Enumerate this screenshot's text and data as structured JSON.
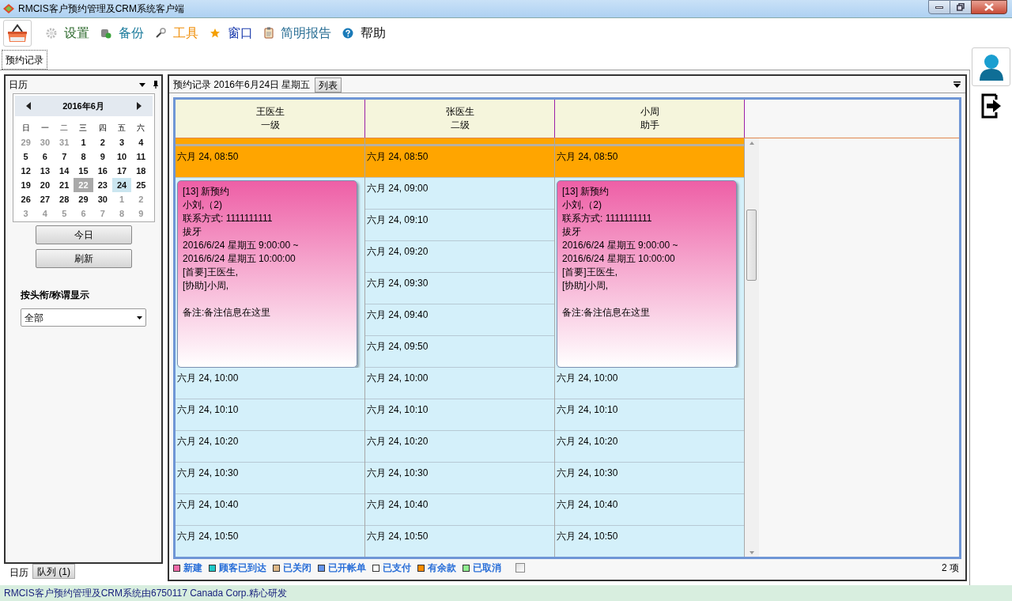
{
  "window": {
    "title": "RMCIS客户预约管理及CRM系统客户端"
  },
  "menu": [
    {
      "label": "设置",
      "color": "#2f6b2f",
      "kind": "gear"
    },
    {
      "label": "备份",
      "color": "#1f7d9e",
      "kind": "database"
    },
    {
      "label": "工具",
      "color": "#f0900c",
      "kind": "wrench"
    },
    {
      "label": "窗口",
      "color": "#1f3fae",
      "kind": "star"
    },
    {
      "label": "简明报告",
      "color": "#2a6f95",
      "kind": "clipboard"
    },
    {
      "label": "帮助",
      "color": "#111111",
      "kind": "help"
    }
  ],
  "doc_tabs": [
    {
      "label": "预约记录",
      "selected": true
    }
  ],
  "calendar_panel": {
    "title": "日历",
    "month": "2016年6月",
    "weekdays": [
      "日",
      "一",
      "二",
      "三",
      "四",
      "五",
      "六"
    ],
    "weeks": [
      [
        {
          "day": "29",
          "muted": true,
          "selected": false,
          "highlighted": false
        },
        {
          "day": "30",
          "muted": true,
          "selected": false,
          "highlighted": false
        },
        {
          "day": "31",
          "muted": true,
          "selected": false,
          "highlighted": false
        },
        {
          "day": "1",
          "muted": false,
          "selected": false,
          "highlighted": false
        },
        {
          "day": "2",
          "muted": false,
          "selected": false,
          "highlighted": false
        },
        {
          "day": "3",
          "muted": false,
          "selected": false,
          "highlighted": false
        },
        {
          "day": "4",
          "muted": false,
          "selected": false,
          "highlighted": false
        }
      ],
      [
        {
          "day": "5",
          "muted": false,
          "selected": false,
          "highlighted": false
        },
        {
          "day": "6",
          "muted": false,
          "selected": false,
          "highlighted": false
        },
        {
          "day": "7",
          "muted": false,
          "selected": false,
          "highlighted": false
        },
        {
          "day": "8",
          "muted": false,
          "selected": false,
          "highlighted": false
        },
        {
          "day": "9",
          "muted": false,
          "selected": false,
          "highlighted": false
        },
        {
          "day": "10",
          "muted": false,
          "selected": false,
          "highlighted": false
        },
        {
          "day": "11",
          "muted": false,
          "selected": false,
          "highlighted": false
        }
      ],
      [
        {
          "day": "12",
          "muted": false,
          "selected": false,
          "highlighted": false
        },
        {
          "day": "13",
          "muted": false,
          "selected": false,
          "highlighted": false
        },
        {
          "day": "14",
          "muted": false,
          "selected": false,
          "highlighted": false
        },
        {
          "day": "15",
          "muted": false,
          "selected": false,
          "highlighted": false
        },
        {
          "day": "16",
          "muted": false,
          "selected": false,
          "highlighted": false
        },
        {
          "day": "17",
          "muted": false,
          "selected": false,
          "highlighted": false
        },
        {
          "day": "18",
          "muted": false,
          "selected": false,
          "highlighted": false
        }
      ],
      [
        {
          "day": "19",
          "muted": false,
          "selected": false,
          "highlighted": false
        },
        {
          "day": "20",
          "muted": false,
          "selected": false,
          "highlighted": false
        },
        {
          "day": "21",
          "muted": false,
          "selected": false,
          "highlighted": false
        },
        {
          "day": "22",
          "muted": false,
          "selected": true,
          "highlighted": false
        },
        {
          "day": "23",
          "muted": false,
          "selected": false,
          "highlighted": false
        },
        {
          "day": "24",
          "muted": false,
          "selected": false,
          "highlighted": true
        },
        {
          "day": "25",
          "muted": false,
          "selected": false,
          "highlighted": false
        }
      ],
      [
        {
          "day": "26",
          "muted": false,
          "selected": false,
          "highlighted": false
        },
        {
          "day": "27",
          "muted": false,
          "selected": false,
          "highlighted": false
        },
        {
          "day": "28",
          "muted": false,
          "selected": false,
          "highlighted": false
        },
        {
          "day": "29",
          "muted": false,
          "selected": false,
          "highlighted": false
        },
        {
          "day": "30",
          "muted": false,
          "selected": false,
          "highlighted": false
        },
        {
          "day": "1",
          "muted": true,
          "selected": false,
          "highlighted": false
        },
        {
          "day": "2",
          "muted": true,
          "selected": false,
          "highlighted": false
        }
      ],
      [
        {
          "day": "3",
          "muted": true,
          "selected": false,
          "highlighted": false
        },
        {
          "day": "4",
          "muted": true,
          "selected": false,
          "highlighted": false
        },
        {
          "day": "5",
          "muted": true,
          "selected": false,
          "highlighted": false
        },
        {
          "day": "6",
          "muted": true,
          "selected": false,
          "highlighted": false
        },
        {
          "day": "7",
          "muted": true,
          "selected": false,
          "highlighted": false
        },
        {
          "day": "8",
          "muted": true,
          "selected": false,
          "highlighted": false
        },
        {
          "day": "9",
          "muted": true,
          "selected": false,
          "highlighted": false
        }
      ]
    ],
    "buttons": [
      "今日",
      "刷新"
    ],
    "filter": {
      "label": "按头衔/称谓显示",
      "value": "全部"
    },
    "bottom_tabs": [
      {
        "label": "日历",
        "selected": true
      },
      {
        "label": "队列 (1)",
        "selected": false
      }
    ]
  },
  "schedule": {
    "title": "预约记录 2016年6月24日 星期五",
    "view_button": "列表",
    "columns": [
      {
        "name": "王医生",
        "rank": "一级",
        "entries": [
          {
            "kind": "slot",
            "time": "六月 24, 08:50",
            "color": "#ffa500"
          },
          {
            "kind": "appointment",
            "color": "#ee5fa6",
            "lines": [
              "[13] 新预约",
              "小刘,（2)",
              "联系方式: 1111111111",
              "拔牙",
              "2016/6/24 星期五 9:00:00 ~",
              "2016/6/24 星期五 10:00:00",
              "[首要]王医生,",
              "[协助]小周,"
            ],
            "notes": "备注:备注信息在这里"
          },
          {
            "kind": "slot",
            "time": "六月 24, 10:00",
            "color": "#d4f0fa"
          },
          {
            "kind": "slot",
            "time": "六月 24, 10:10",
            "color": "#d4f0fa"
          },
          {
            "kind": "slot",
            "time": "六月 24, 10:20",
            "color": "#d4f0fa"
          },
          {
            "kind": "slot",
            "time": "六月 24, 10:30",
            "color": "#d4f0fa"
          },
          {
            "kind": "slot",
            "time": "六月 24, 10:40",
            "color": "#d4f0fa"
          },
          {
            "kind": "slot",
            "time": "六月 24, 10:50",
            "color": "#d4f0fa"
          }
        ]
      },
      {
        "name": "张医生",
        "rank": "二级",
        "entries": [
          {
            "kind": "slot",
            "time": "六月 24, 08:50",
            "color": "#ffa500"
          },
          {
            "kind": "slot",
            "time": "六月 24, 09:00",
            "color": "#d4f0fa"
          },
          {
            "kind": "slot",
            "time": "六月 24, 09:10",
            "color": "#d4f0fa"
          },
          {
            "kind": "slot",
            "time": "六月 24, 09:20",
            "color": "#d4f0fa"
          },
          {
            "kind": "slot",
            "time": "六月 24, 09:30",
            "color": "#d4f0fa"
          },
          {
            "kind": "slot",
            "time": "六月 24, 09:40",
            "color": "#d4f0fa"
          },
          {
            "kind": "slot",
            "time": "六月 24, 09:50",
            "color": "#d4f0fa"
          },
          {
            "kind": "slot",
            "time": "六月 24, 10:00",
            "color": "#d4f0fa"
          },
          {
            "kind": "slot",
            "time": "六月 24, 10:10",
            "color": "#d4f0fa"
          },
          {
            "kind": "slot",
            "time": "六月 24, 10:20",
            "color": "#d4f0fa"
          },
          {
            "kind": "slot",
            "time": "六月 24, 10:30",
            "color": "#d4f0fa"
          },
          {
            "kind": "slot",
            "time": "六月 24, 10:40",
            "color": "#d4f0fa"
          },
          {
            "kind": "slot",
            "time": "六月 24, 10:50",
            "color": "#d4f0fa"
          }
        ]
      },
      {
        "name": "小周",
        "rank": "助手",
        "entries": [
          {
            "kind": "slot",
            "time": "六月 24, 08:50",
            "color": "#ffa500"
          },
          {
            "kind": "appointment",
            "color": "#ee5fa6",
            "lines": [
              "[13] 新预约",
              "小刘,（2)",
              "联系方式: 1111111111",
              "拔牙",
              "2016/6/24 星期五 9:00:00 ~",
              "2016/6/24 星期五 10:00:00",
              "[首要]王医生,",
              "[协助]小周,"
            ],
            "notes": "备注:备注信息在这里"
          },
          {
            "kind": "slot",
            "time": "六月 24, 10:00",
            "color": "#d4f0fa"
          },
          {
            "kind": "slot",
            "time": "六月 24, 10:10",
            "color": "#d4f0fa"
          },
          {
            "kind": "slot",
            "time": "六月 24, 10:20",
            "color": "#d4f0fa"
          },
          {
            "kind": "slot",
            "time": "六月 24, 10:30",
            "color": "#d4f0fa"
          },
          {
            "kind": "slot",
            "time": "六月 24, 10:40",
            "color": "#d4f0fa"
          },
          {
            "kind": "slot",
            "time": "六月 24, 10:50",
            "color": "#d4f0fa"
          }
        ]
      }
    ],
    "legend": [
      {
        "label": "新建",
        "color": "#f06aa8"
      },
      {
        "label": "顾客已到达",
        "color": "#1ec8c8"
      },
      {
        "label": "已关闭",
        "color": "#deb887"
      },
      {
        "label": "已开帐单",
        "color": "#6495ed"
      },
      {
        "label": "已支付",
        "color": "#ffffff"
      },
      {
        "label": "有余款",
        "color": "#ff8c00"
      },
      {
        "label": "已取消",
        "color": "#90ee90"
      }
    ],
    "legend_checkbox": {
      "checked": false
    },
    "count": "2 项"
  },
  "status_bar": "RMCIS客户预约管理及CRM系统由6750117 Canada Corp.精心研发"
}
